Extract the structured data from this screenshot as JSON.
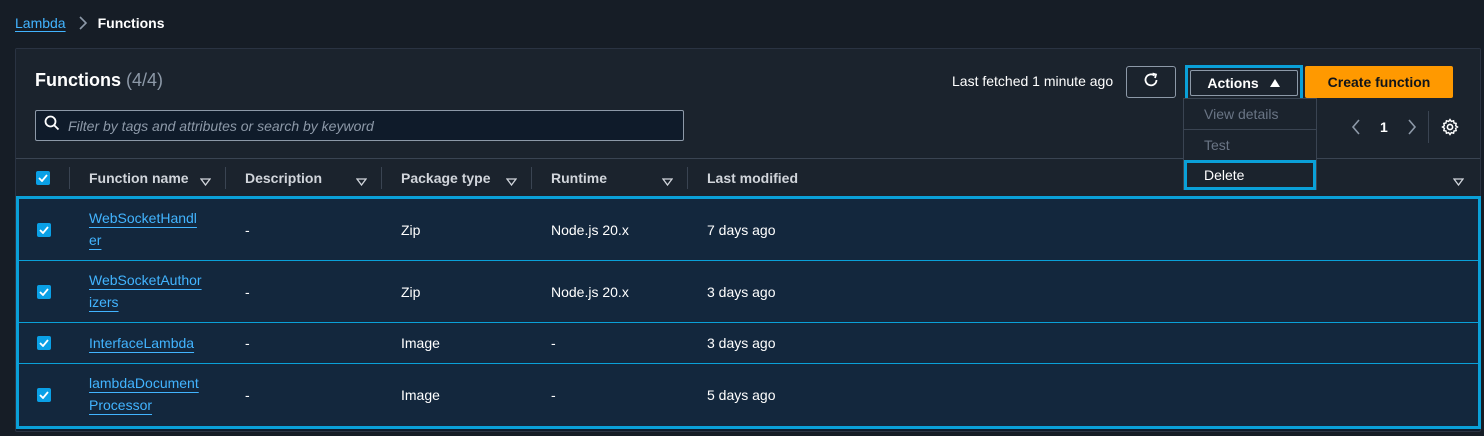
{
  "breadcrumb": {
    "root": "Lambda",
    "current": "Functions"
  },
  "panel": {
    "title": "Functions",
    "count": "(4/4)",
    "last_fetched": "Last fetched 1 minute ago",
    "actions_label": "Actions",
    "create_label": "Create function",
    "search_placeholder": "Filter by tags and attributes or search by keyword",
    "page": "1"
  },
  "actions_menu": {
    "view_details": "View details",
    "test": "Test",
    "delete": "Delete"
  },
  "columns": {
    "name": "Function name",
    "description": "Description",
    "package": "Package type",
    "runtime": "Runtime",
    "modified": "Last modified"
  },
  "rows": [
    {
      "name_1": "WebSocketHandl",
      "name_2": "er",
      "description": "-",
      "package": "Zip",
      "runtime": "Node.js 20.x",
      "modified": "7 days ago"
    },
    {
      "name_1": "WebSocketAuthor",
      "name_2": "izers",
      "description": "-",
      "package": "Zip",
      "runtime": "Node.js 20.x",
      "modified": "3 days ago"
    },
    {
      "name_1": "InterfaceLambda",
      "name_2": "",
      "description": "-",
      "package": "Image",
      "runtime": "-",
      "modified": "3 days ago"
    },
    {
      "name_1": "lambdaDocument",
      "name_2": "Processor",
      "description": "-",
      "package": "Image",
      "runtime": "-",
      "modified": "5 days ago"
    }
  ],
  "colors": {
    "accent": "#0aa0d8",
    "link": "#42b4ff",
    "primary": "#ff9900"
  },
  "icons": [
    "chevron-right-icon",
    "refresh-icon",
    "triangle-up-icon",
    "search-icon",
    "chevron-left-icon",
    "gear-icon",
    "caret-down-icon",
    "checkbox-checked-icon"
  ]
}
